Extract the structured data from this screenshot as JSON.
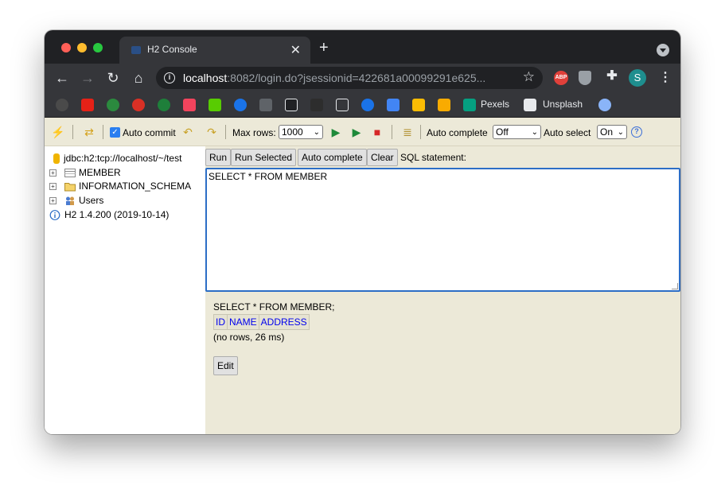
{
  "browser": {
    "tab_title": "H2 Console",
    "tab_close": "✕",
    "new_tab": "+",
    "url_host": "localhost",
    "url_rest": ":8082/login.do?jsessionid=422681a00099291e625...",
    "avatar_letter": "S",
    "abp_label": "ABP",
    "bookmarks": [
      {
        "label": "Pexels"
      },
      {
        "label": "Unsplash"
      }
    ]
  },
  "toolbar": {
    "auto_commit_label": "Auto commit",
    "max_rows_label": "Max rows:",
    "max_rows_value": "1000",
    "auto_complete_label": "Auto complete",
    "auto_complete_value": "Off",
    "auto_select_label": "Auto select",
    "auto_select_value": "On",
    "help": "?"
  },
  "tree": {
    "connection": "jdbc:h2:tcp://localhost/~/test",
    "items": [
      {
        "label": "MEMBER"
      },
      {
        "label": "INFORMATION_SCHEMA"
      },
      {
        "label": "Users"
      }
    ],
    "version": "H2 1.4.200 (2019-10-14)"
  },
  "editor": {
    "buttons": {
      "run": "Run",
      "run_selected": "Run Selected",
      "auto_complete": "Auto complete",
      "clear": "Clear"
    },
    "sql_label": "SQL statement:",
    "sql_text": "SELECT * FROM MEMBER"
  },
  "result": {
    "query": "SELECT * FROM MEMBER;",
    "columns": [
      "ID",
      "NAME",
      "ADDRESS"
    ],
    "status": "(no rows, 26 ms)",
    "edit_label": "Edit"
  },
  "colors": {
    "page_bg": "#ece9d8",
    "link_blue": "#0000ee",
    "editor_border": "#2c6ec6"
  }
}
